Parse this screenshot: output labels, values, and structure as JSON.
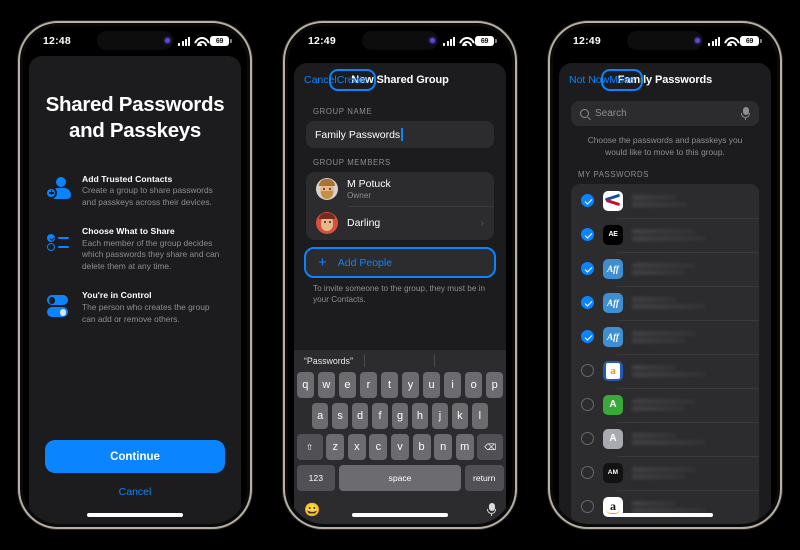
{
  "phone1": {
    "status": {
      "time": "12:48",
      "battery": "69"
    },
    "title": "Shared Passwords and Passkeys",
    "features": [
      {
        "icon": "person-add-icon",
        "title": "Add Trusted Contacts",
        "desc": "Create a group to share passwords and passkeys across their devices."
      },
      {
        "icon": "checklist-icon",
        "title": "Choose What to Share",
        "desc": "Each member of the group decides which passwords they share and can delete them at any time."
      },
      {
        "icon": "toggles-icon",
        "title": "You're in Control",
        "desc": "The person who creates the group can add or remove others."
      }
    ],
    "continue_label": "Continue",
    "cancel_label": "Cancel"
  },
  "phone2": {
    "status": {
      "time": "12:49",
      "battery": "69"
    },
    "nav": {
      "left": "Cancel",
      "title": "New Shared Group",
      "right": "Create"
    },
    "group_name_label": "GROUP NAME",
    "group_name_value": "Family Passwords",
    "group_members_label": "GROUP MEMBERS",
    "members": [
      {
        "name": "M Potuck",
        "sub": "Owner",
        "avatar": "memoji-beige"
      },
      {
        "name": "Darling",
        "sub": "",
        "avatar": "memoji-red"
      }
    ],
    "add_people_label": "Add People",
    "footnote": "To invite someone to the group, they must be in your Contacts.",
    "keyboard": {
      "suggestion": "“Passwords”",
      "row1": [
        "q",
        "w",
        "e",
        "r",
        "t",
        "y",
        "u",
        "i",
        "o",
        "p"
      ],
      "row2": [
        "a",
        "s",
        "d",
        "f",
        "g",
        "h",
        "j",
        "k",
        "l"
      ],
      "row3": [
        "z",
        "x",
        "c",
        "v",
        "b",
        "n",
        "m"
      ],
      "shift": "⇧",
      "backspace": "⌫",
      "numbers": "123",
      "space": "space",
      "return": "return",
      "emoji": "😀",
      "mic": "mic-icon"
    }
  },
  "phone3": {
    "status": {
      "time": "12:49",
      "battery": "69"
    },
    "nav": {
      "left": "Not Now",
      "title": "Family Passwords",
      "right": "Move"
    },
    "search_placeholder": "Search",
    "helper": "Choose the passwords and passkeys you would like to move to this group.",
    "list_label": "MY PASSWORDS",
    "items": [
      {
        "icon": "american-airlines-favicon",
        "checked": true,
        "glyph": ""
      },
      {
        "icon": "adobe-express-favicon",
        "checked": true,
        "glyph": "AE"
      },
      {
        "icon": "aff-blue-favicon-1",
        "checked": true,
        "glyph": "Aff"
      },
      {
        "icon": "aff-blue-favicon-2",
        "checked": true,
        "glyph": "Aff"
      },
      {
        "icon": "aff-blue-favicon-3",
        "checked": true,
        "glyph": "Aff"
      },
      {
        "icon": "a-blue-orange-favicon",
        "checked": false,
        "glyph": "a"
      },
      {
        "icon": "a-green-favicon",
        "checked": false,
        "glyph": "A"
      },
      {
        "icon": "a-gray-favicon",
        "checked": false,
        "glyph": "A"
      },
      {
        "icon": "am-black-favicon",
        "checked": false,
        "glyph": "AM"
      },
      {
        "icon": "amazon-favicon",
        "checked": false,
        "glyph": "a"
      }
    ]
  },
  "colors": {
    "accent": "#0a84ff",
    "sheet": "#1c1c1e",
    "card": "#2c2c2e",
    "muted": "#8e8e93"
  }
}
